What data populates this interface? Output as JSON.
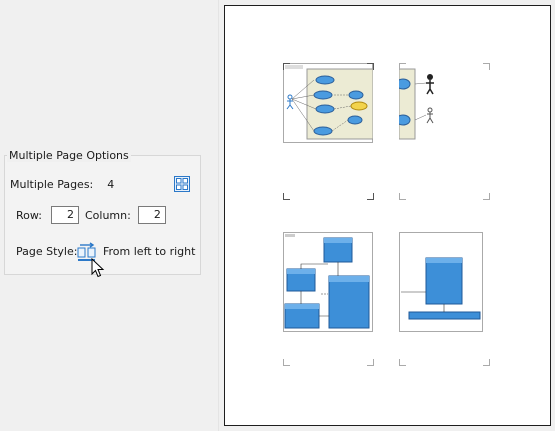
{
  "options": {
    "group_title": "Multiple Page Options",
    "pages_label": "Multiple Pages:",
    "pages_value": "4",
    "row_label": "Row:",
    "row_value": "2",
    "column_label": "Column:",
    "column_value": "2",
    "style_label": "Page Style:",
    "style_value": "From left to right"
  },
  "colors": {
    "accent": "#2b78c8",
    "bubble": "#4a9be0",
    "panel_bg": "#f0f0f0",
    "diagram_bg": "#ecebd4"
  }
}
